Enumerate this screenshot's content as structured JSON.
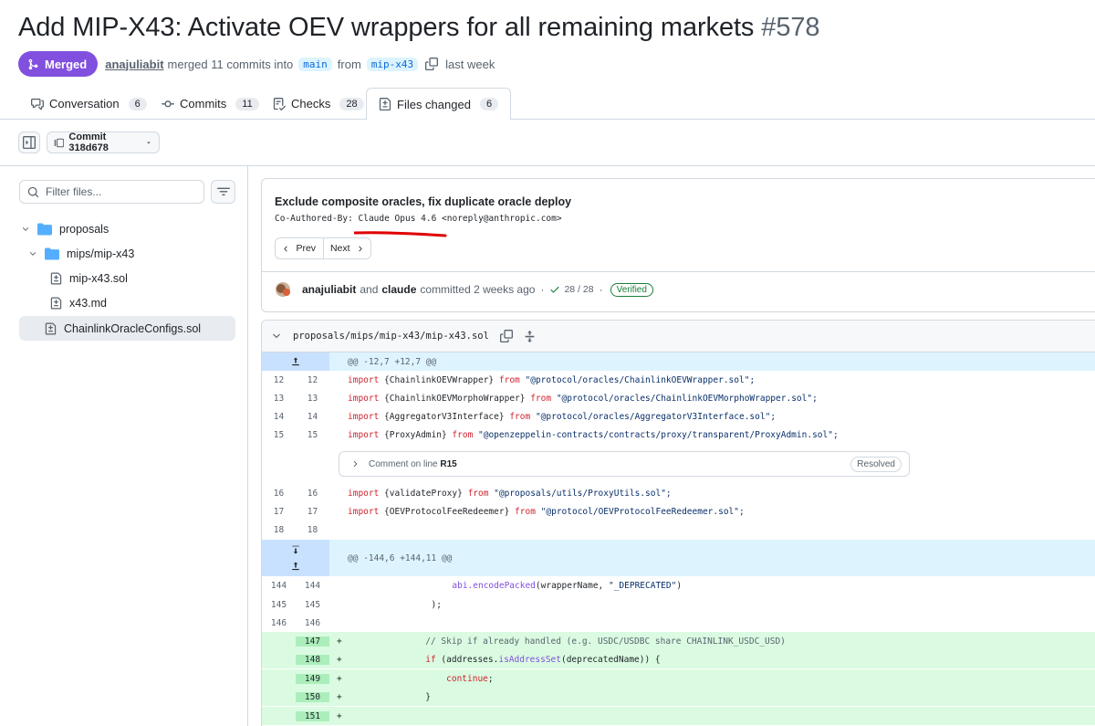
{
  "header": {
    "title": "Add MIP-X43: Activate OEV wrappers for all remaining markets",
    "number": "#578",
    "status": "Merged",
    "author": "anajuliabit",
    "merged_text": "merged 11 commits into",
    "base_branch": "main",
    "from_text": "from",
    "head_branch": "mip-x43",
    "time": "last week"
  },
  "tabs": [
    {
      "label": "Conversation",
      "count": "6",
      "icon": "comment-discussion-icon"
    },
    {
      "label": "Commits",
      "count": "11",
      "icon": "git-commit-icon"
    },
    {
      "label": "Checks",
      "count": "28",
      "icon": "checklist-icon"
    },
    {
      "label": "Files changed",
      "count": "6",
      "icon": "file-diff-icon",
      "active": true
    }
  ],
  "toolbar": {
    "commit_label": "Commit 318d678"
  },
  "sidebar": {
    "filter_placeholder": "Filter files...",
    "tree": [
      {
        "label": "proposals",
        "type": "folder"
      },
      {
        "label": "mips/mip-x43",
        "type": "folder"
      },
      {
        "label": "mip-x43.sol",
        "type": "file"
      },
      {
        "label": "x43.md",
        "type": "file"
      },
      {
        "label": "ChainlinkOracleConfigs.sol",
        "type": "file",
        "selected": true
      }
    ]
  },
  "commit": {
    "title": "Exclude composite oracles, fix duplicate oracle deploy",
    "coauthor_prefix": "Co-Authored-By: ",
    "coauthor_name": "Claude Opus 4.6",
    "coauthor_email": " <noreply@anthropic.com>",
    "prev_label": "Prev",
    "next_label": "Next",
    "author1": "anajuliabit",
    "and_text": "and",
    "author2": "claude",
    "committed_text": "committed 2 weeks ago",
    "dot": "·",
    "checks": "28 / 28",
    "verified": "Verified"
  },
  "diff": {
    "path": "proposals/mips/mip-x43/mip-x43.sol",
    "hunk1": "@@ -12,7 +12,7 @@",
    "hunk2": "@@ -144,6 +144,11 @@",
    "comment_prefix": "Comment on line",
    "comment_line": "R15",
    "resolved": "Resolved",
    "lines": {
      "l12": {
        "old": "12",
        "new": "12",
        "kw": "import",
        "a": " {ChainlinkOEVWrapper} ",
        "from": "from",
        "s": " \"@protocol/oracles/ChainlinkOEVWrapper.sol\";"
      },
      "l13": {
        "old": "13",
        "new": "13",
        "kw": "import",
        "a": " {ChainlinkOEVMorphoWrapper} ",
        "from": "from",
        "s": " \"@protocol/oracles/ChainlinkOEVMorphoWrapper.sol\";"
      },
      "l14": {
        "old": "14",
        "new": "14",
        "kw": "import",
        "a": " {AggregatorV3Interface} ",
        "from": "from",
        "s": " \"@protocol/oracles/AggregatorV3Interface.sol\";"
      },
      "l15": {
        "old": "15",
        "new": "15",
        "kw": "import",
        "a": " {ProxyAdmin} ",
        "from": "from",
        "s": " \"@openzeppelin-contracts/contracts/proxy/transparent/ProxyAdmin.sol\";"
      },
      "l16": {
        "old": "16",
        "new": "16",
        "kw": "import",
        "a": " {validateProxy} ",
        "from": "from",
        "s": " \"@proposals/utils/ProxyUtils.sol\";"
      },
      "l17": {
        "old": "17",
        "new": "17",
        "kw": "import",
        "a": " {OEVProtocolFeeRedeemer} ",
        "from": "from",
        "s": " \"@protocol/OEVProtocolFeeRedeemer.sol\";"
      },
      "l18": {
        "old": "18",
        "new": "18"
      },
      "l144": {
        "old": "144",
        "new": "144",
        "indent": "                    ",
        "fn": "abi.encodePacked",
        "a": "(wrapperName, ",
        "s": "\"_DEPRECATED\"",
        "b": ")"
      },
      "l145": {
        "old": "145",
        "new": "145",
        "code": "                );"
      },
      "l146": {
        "old": "146",
        "new": "146"
      },
      "l147": {
        "new": "147",
        "sign": "+",
        "code": "                // Skip if already handled (e.g. USDC/USDBC share CHAINLINK_USDC_USD)"
      },
      "l148": {
        "new": "148",
        "sign": "+",
        "indent": "                ",
        "kw": "if",
        "a": " (addresses.",
        "fn": "isAddressSet",
        "b": "(deprecatedName)) {"
      },
      "l149": {
        "new": "149",
        "sign": "+",
        "indent": "                    ",
        "kw": "continue",
        "b": ";"
      },
      "l150": {
        "new": "150",
        "sign": "+",
        "code": "                }"
      },
      "l151": {
        "new": "151",
        "sign": "+",
        "code": ""
      }
    }
  },
  "colors": {
    "merged": "#8250df",
    "accent": "#0969da",
    "success": "#1a7f37",
    "annotation": "#e00000"
  }
}
